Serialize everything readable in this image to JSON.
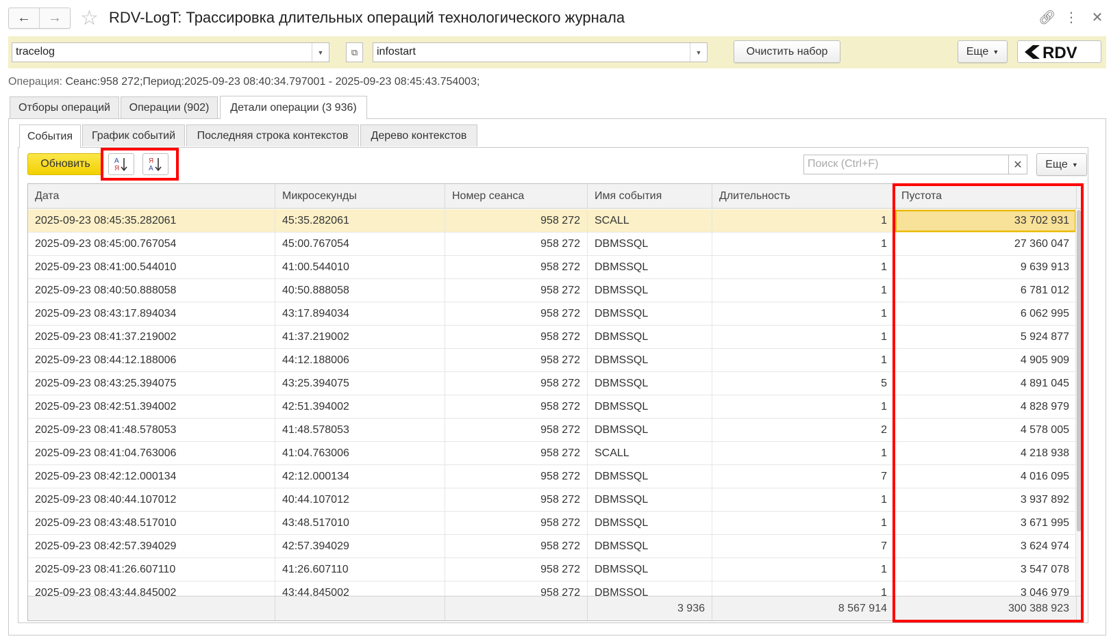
{
  "window": {
    "title": "RDV-LogT: Трассировка длительных операций технологического журнала"
  },
  "toolbar": {
    "log_field_value": "tracelog",
    "base_field_value": "infostart",
    "clear_label": "Очистить набор",
    "more_label": "Еще",
    "logo_text": "RDV"
  },
  "operation": {
    "label": "Операция:",
    "value": "Сеанс:958 272;Период:2025-09-23 08:40:34.797001 - 2025-09-23 08:45:43.754003;"
  },
  "outer_tabs": [
    {
      "label": "Отборы операций"
    },
    {
      "label": "Операции (902)"
    },
    {
      "label": "Детали операции (3 936)"
    }
  ],
  "inner_tabs": [
    {
      "label": "События"
    },
    {
      "label": "График событий"
    },
    {
      "label": "Последняя строка контекстов"
    },
    {
      "label": "Дерево контекстов"
    }
  ],
  "events": {
    "refresh_label": "Обновить",
    "search_placeholder": "Поиск (Ctrl+F)",
    "more_label": "Еще",
    "columns": [
      "Дата",
      "Микросекунды",
      "Номер сеанса",
      "Имя события",
      "Длительность",
      "Пустота"
    ],
    "rows": [
      {
        "date": "2025-09-23 08:45:35.282061",
        "micro": "45:35.282061",
        "session": "958 272",
        "event": "SCALL",
        "duration": "1",
        "void": "33 702 931"
      },
      {
        "date": "2025-09-23 08:45:00.767054",
        "micro": "45:00.767054",
        "session": "958 272",
        "event": "DBMSSQL",
        "duration": "1",
        "void": "27 360 047"
      },
      {
        "date": "2025-09-23 08:41:00.544010",
        "micro": "41:00.544010",
        "session": "958 272",
        "event": "DBMSSQL",
        "duration": "1",
        "void": "9 639 913"
      },
      {
        "date": "2025-09-23 08:40:50.888058",
        "micro": "40:50.888058",
        "session": "958 272",
        "event": "DBMSSQL",
        "duration": "1",
        "void": "6 781 012"
      },
      {
        "date": "2025-09-23 08:43:17.894034",
        "micro": "43:17.894034",
        "session": "958 272",
        "event": "DBMSSQL",
        "duration": "1",
        "void": "6 062 995"
      },
      {
        "date": "2025-09-23 08:41:37.219002",
        "micro": "41:37.219002",
        "session": "958 272",
        "event": "DBMSSQL",
        "duration": "1",
        "void": "5 924 877"
      },
      {
        "date": "2025-09-23 08:44:12.188006",
        "micro": "44:12.188006",
        "session": "958 272",
        "event": "DBMSSQL",
        "duration": "1",
        "void": "4 905 909"
      },
      {
        "date": "2025-09-23 08:43:25.394075",
        "micro": "43:25.394075",
        "session": "958 272",
        "event": "DBMSSQL",
        "duration": "5",
        "void": "4 891 045"
      },
      {
        "date": "2025-09-23 08:42:51.394002",
        "micro": "42:51.394002",
        "session": "958 272",
        "event": "DBMSSQL",
        "duration": "1",
        "void": "4 828 979"
      },
      {
        "date": "2025-09-23 08:41:48.578053",
        "micro": "41:48.578053",
        "session": "958 272",
        "event": "DBMSSQL",
        "duration": "2",
        "void": "4 578 005"
      },
      {
        "date": "2025-09-23 08:41:04.763006",
        "micro": "41:04.763006",
        "session": "958 272",
        "event": "SCALL",
        "duration": "1",
        "void": "4 218 938"
      },
      {
        "date": "2025-09-23 08:42:12.000134",
        "micro": "42:12.000134",
        "session": "958 272",
        "event": "DBMSSQL",
        "duration": "7",
        "void": "4 016 095"
      },
      {
        "date": "2025-09-23 08:40:44.107012",
        "micro": "40:44.107012",
        "session": "958 272",
        "event": "DBMSSQL",
        "duration": "1",
        "void": "3 937 892"
      },
      {
        "date": "2025-09-23 08:43:48.517010",
        "micro": "43:48.517010",
        "session": "958 272",
        "event": "DBMSSQL",
        "duration": "1",
        "void": "3 671 995"
      },
      {
        "date": "2025-09-23 08:42:57.394029",
        "micro": "42:57.394029",
        "session": "958 272",
        "event": "DBMSSQL",
        "duration": "7",
        "void": "3 624 974"
      },
      {
        "date": "2025-09-23 08:41:26.607110",
        "micro": "41:26.607110",
        "session": "958 272",
        "event": "DBMSSQL",
        "duration": "1",
        "void": "3 547 078"
      },
      {
        "date": "2025-09-23 08:43:44.845002",
        "micro": "43:44.845002",
        "session": "958 272",
        "event": "DBMSSQL",
        "duration": "1",
        "void": "3 046 979"
      }
    ],
    "totals": {
      "event": "3 936",
      "duration": "8 567 914",
      "void": "300 388 923"
    }
  },
  "colors": {
    "highlight": "#ff0000",
    "accent_yellow": "#f2d000",
    "panel_yellow": "#f4f0c9",
    "selection": "#fbf0c8"
  }
}
